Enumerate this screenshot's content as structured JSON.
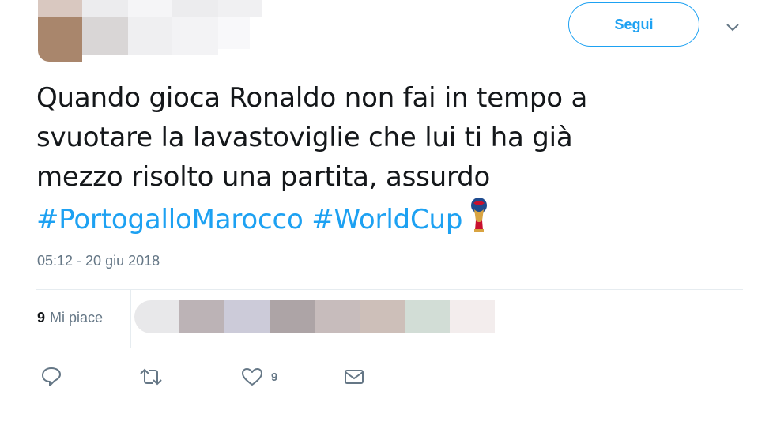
{
  "header": {
    "follow_label": "Segui"
  },
  "tweet": {
    "lines": [
      "Quando gioca Ronaldo non fai in tempo a",
      "svuotare la lavastoviglie che lui ti ha già",
      "mezzo risolto una partita, assurdo"
    ],
    "hashtags": [
      "#PortogalloMarocco",
      "#WorldCup"
    ],
    "timestamp": "05:12 - 20 giu 2018"
  },
  "stats": {
    "likes_count": "9",
    "likes_label": "Mi piace"
  },
  "actions": {
    "like_count": "9"
  },
  "colors": {
    "accent": "#1da1f2",
    "muted": "#657786",
    "text": "#14171a"
  },
  "icons": [
    "caret-down-icon",
    "trophy-emoji-icon",
    "reply-icon",
    "retweet-icon",
    "like-icon",
    "message-icon"
  ]
}
